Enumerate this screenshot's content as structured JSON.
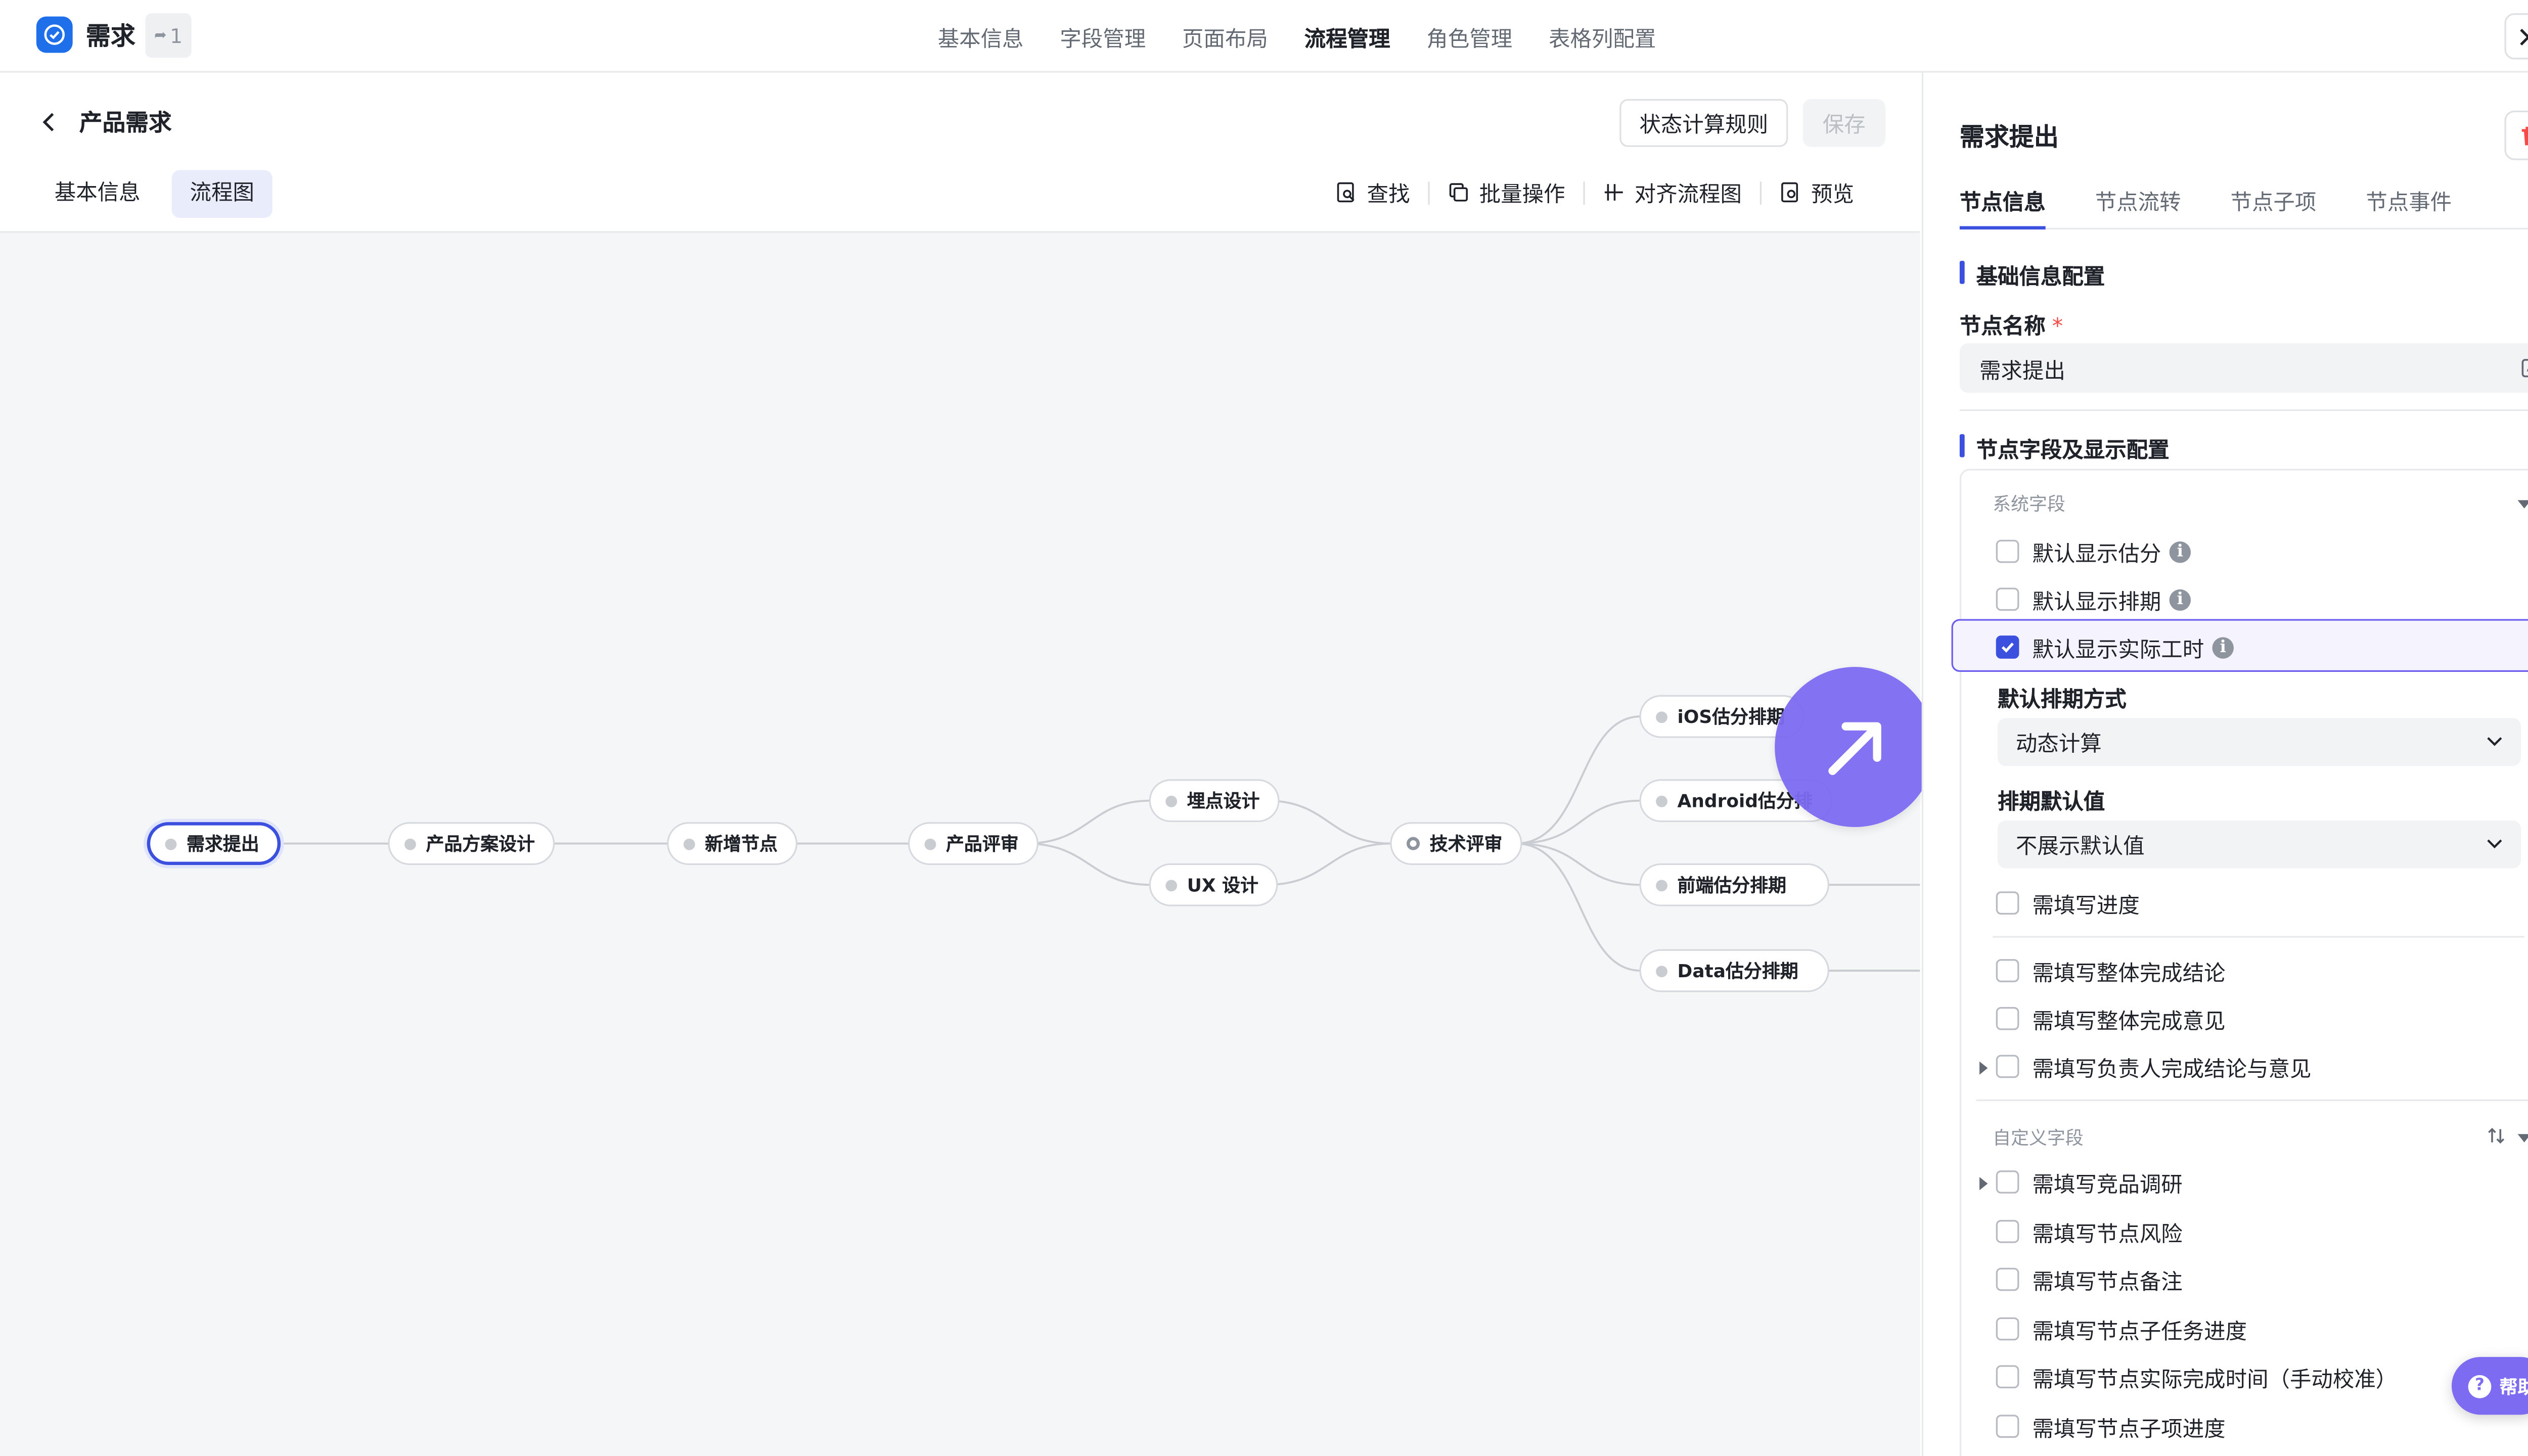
{
  "app": {
    "title": "需求",
    "badge": "1",
    "accent": "#1f6feb"
  },
  "top_nav": [
    {
      "label": "基本信息"
    },
    {
      "label": "字段管理"
    },
    {
      "label": "页面布局"
    },
    {
      "label": "流程管理",
      "active": true
    },
    {
      "label": "角色管理"
    },
    {
      "label": "表格列配置"
    }
  ],
  "page": {
    "title": "产品需求",
    "rules_button": "状态计算规则",
    "save_button": "保存",
    "subtabs": [
      "基本信息",
      "流程图"
    ],
    "toolbar": {
      "find": "查找",
      "batch": "批量操作",
      "align": "对齐流程图",
      "preview": "预览"
    }
  },
  "flow": {
    "nodes": {
      "n1": "需求提出",
      "n2": "产品方案设计",
      "n3": "新增节点",
      "n4": "产品评审",
      "n5": "埋点设计",
      "n6": "UX 设计",
      "n7": "技术评审",
      "n8": "iOS估分排期",
      "n9": "Android估分排",
      "n10": "前端估分排期",
      "n11": "Data估分排期"
    },
    "selected": "n1",
    "edge_color": "#c9ccd1",
    "selected_color": "#3c50e0"
  },
  "panel": {
    "title": "需求提出",
    "tabs": [
      "节点信息",
      "节点流转",
      "节点子项",
      "节点事件"
    ],
    "basic_section": "基础信息配置",
    "name_label": "节点名称",
    "required_mark": "*",
    "name_value": "需求提出",
    "fields_section": "节点字段及显示配置",
    "system_group": "系统字段",
    "system_fields": [
      {
        "label": "默认显示估分",
        "checked": false,
        "info": "i"
      },
      {
        "label": "默认显示排期",
        "checked": false,
        "info": "i"
      },
      {
        "label": "默认显示实际工时",
        "checked": true,
        "info": "i"
      }
    ],
    "schedule_mode_label": "默认排期方式",
    "schedule_mode_value": "动态计算",
    "schedule_default_label": "排期默认值",
    "schedule_default_value": "不展示默认值",
    "more_system": [
      {
        "label": "需填写进度",
        "checked": false
      },
      {
        "label": "需填写整体完成结论",
        "checked": false
      },
      {
        "label": "需填写整体完成意见",
        "checked": false
      },
      {
        "label": "需填写负责人完成结论与意见",
        "checked": false
      }
    ],
    "custom_group": "自定义字段",
    "custom_fields": [
      {
        "label": "需填写竞品调研",
        "checked": false
      },
      {
        "label": "需填写节点风险",
        "checked": false
      },
      {
        "label": "需填写节点备注",
        "checked": false
      },
      {
        "label": "需填写节点子任务进度",
        "checked": false
      },
      {
        "label": "需填写节点实际完成时间（手动校准）",
        "checked": false
      },
      {
        "label": "需填写节点子项进度",
        "checked": false
      }
    ]
  },
  "help": {
    "label": "帮助",
    "icon": "?"
  },
  "colors": {
    "primary": "#3c50e0",
    "fab": "#7d6bf2",
    "danger": "#f54a45"
  }
}
